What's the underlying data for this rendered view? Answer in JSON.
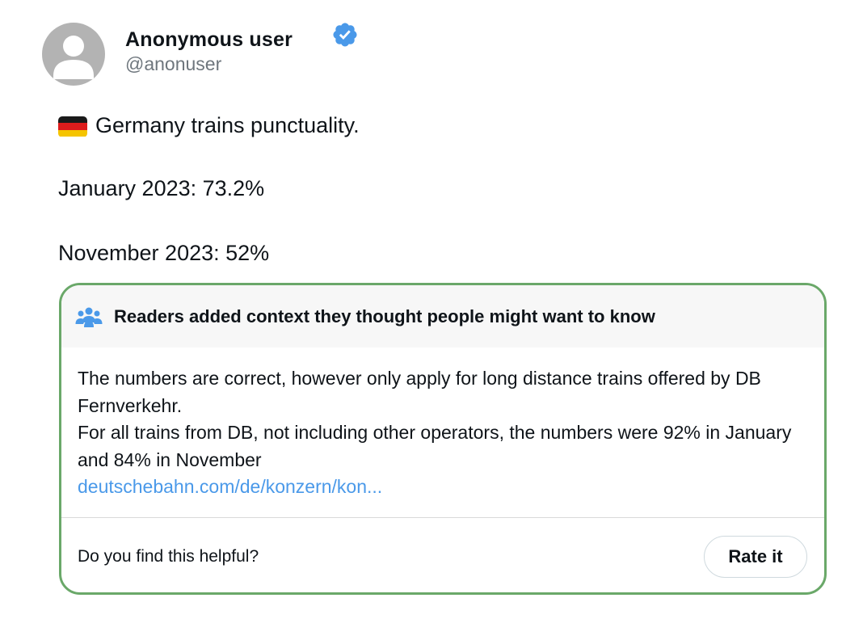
{
  "user": {
    "display_name": "Anonymous user",
    "handle": "@anonuser",
    "verified_icon": "verified-badge-icon",
    "avatar_icon": "default-avatar-icon"
  },
  "tweet": {
    "flag_icon": "germany-flag-icon",
    "line1": "Germany trains punctuality.",
    "line2": "January 2023: 73.2%",
    "line3": "November 2023: 52%"
  },
  "community_note": {
    "header_icon": "people-icon",
    "title": "Readers added context they thought people might want to know",
    "body_line1": "The numbers are correct, however only apply for long distance trains offered by DB Fernverkehr.",
    "body_line2": "For all trains from DB, not including other operators, the numbers were 92% in January and 84% in November",
    "link_text": "deutschebahn.com/de/konzern/kon...",
    "helpful_prompt": "Do you find this helpful?",
    "rate_button": "Rate it"
  },
  "colors": {
    "note_border": "#6aa869",
    "link": "#4a99e9",
    "verified": "#4a99e9",
    "handle": "#6e767d"
  }
}
